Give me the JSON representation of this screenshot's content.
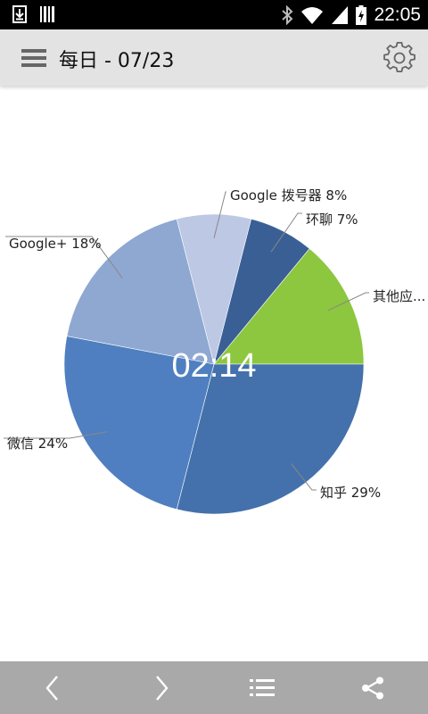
{
  "status_bar": {
    "time": "22:05",
    "icons": [
      "download-icon",
      "barcode-icon",
      "bluetooth-icon",
      "wifi-icon",
      "signal-icon",
      "battery-charging-icon"
    ]
  },
  "app_bar": {
    "menu_icon": "hamburger-menu-icon",
    "title": "每日 - 07/23",
    "settings_icon": "gear-icon"
  },
  "chart_data": {
    "type": "pie",
    "center_label": "02:14",
    "slices": [
      {
        "label": "其他应...",
        "value": 14,
        "color": "#8dc63f"
      },
      {
        "label": "知乎 29%",
        "value": 29,
        "color": "#4471ab"
      },
      {
        "label": "微信 24%",
        "value": 24,
        "color": "#4f7fc0"
      },
      {
        "label": "Google+ 18%",
        "value": 18,
        "color": "#8ea8d2"
      },
      {
        "label": "Google 拨号器 8%",
        "value": 8,
        "color": "#bcc8e4"
      },
      {
        "label": "环聊 7%",
        "value": 7,
        "color": "#3a5f95"
      }
    ]
  },
  "bottom_bar": {
    "icons": [
      "chevron-left-icon",
      "chevron-right-icon",
      "list-icon",
      "share-icon"
    ]
  }
}
